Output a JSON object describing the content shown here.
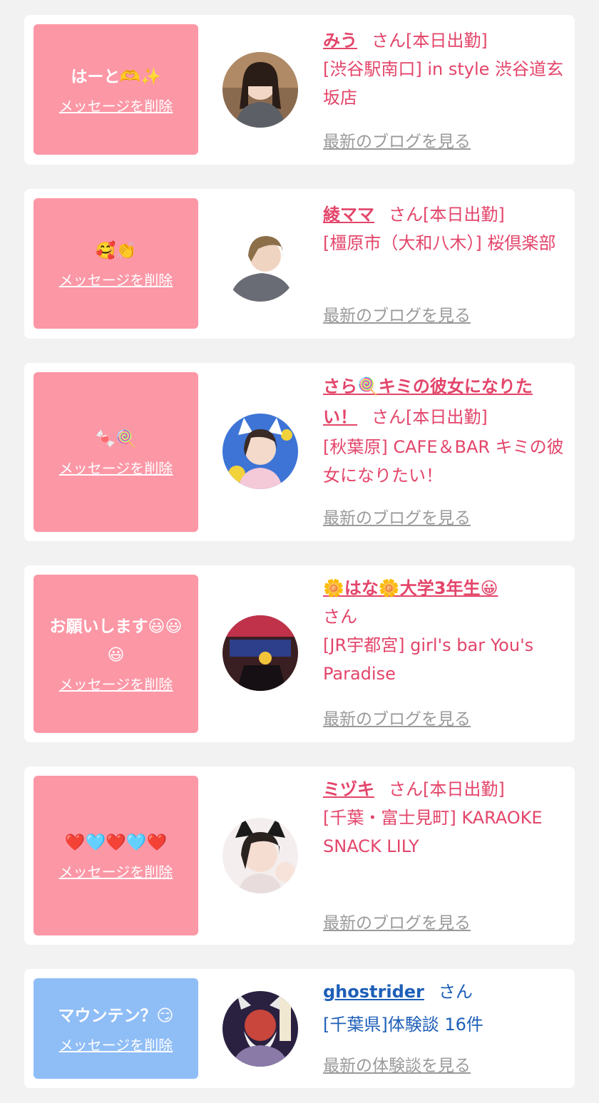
{
  "delete_label": "メッセージを削除",
  "cards": [
    {
      "message": "はーと🫶✨",
      "name": "みう",
      "suffix": "さん[本日出勤]",
      "shop": "[渋谷駅南口] in style 渋谷道玄坂店",
      "more": "最新のブログを見る"
    },
    {
      "message": "🥰👏",
      "name": "綾ママ",
      "suffix": "さん[本日出勤]",
      "shop": "[橿原市（大和八木）] 桜倶楽部",
      "more": "最新のブログを見る"
    },
    {
      "message": "🍬🍭",
      "name": "さら🍭キミの彼女になりたい！",
      "suffix": "さん[本日出勤]",
      "shop": "[秋葉原] CAFE＆BAR キミの彼女になりたい！",
      "more": "最新のブログを見る"
    },
    {
      "message": "お願いします😃😃😃",
      "name": "🌼はな🌼大学3年生😀",
      "suffix": "さん",
      "shop": "[JR宇都宮] girl's bar You's Paradise",
      "more": "最新のブログを見る"
    },
    {
      "message": "❤️🩵❤️🩵❤️",
      "name": "ミヅキ",
      "suffix": "さん[本日出勤]",
      "shop": "[千葉・富士見町] KARAOKE SNACK LILY",
      "more": "最新のブログを見る"
    },
    {
      "message": "マウンテン？😏",
      "name": "ghostrider",
      "suffix": "さん",
      "shop": "[千葉県]体験談 16件",
      "more": "最新の体験談を見る"
    }
  ]
}
